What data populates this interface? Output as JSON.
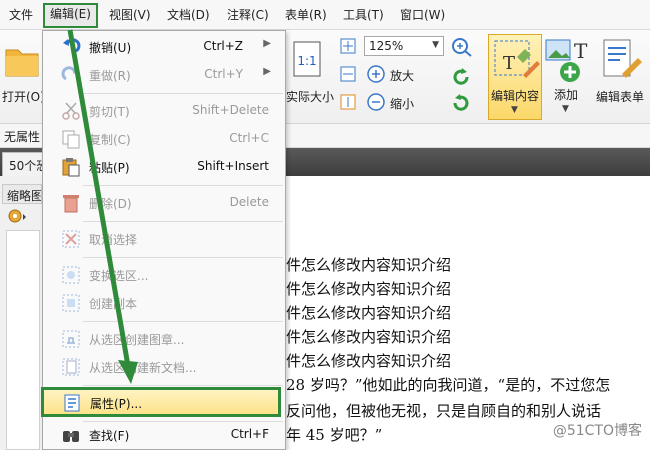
{
  "menubar": {
    "items": [
      "文件",
      "编辑(E)",
      "视图(V)",
      "文档(D)",
      "注释(C)",
      "表单(R)",
      "工具(T)",
      "窗口(W)"
    ],
    "active_index": 1
  },
  "ribbon": {
    "open_label": "打开(O)",
    "actual_size_label": "实际大小",
    "zoom_value": "125%",
    "zoom_in_label": "放大",
    "zoom_out_label": "缩小",
    "edit_content_label": "编辑内容",
    "add_label": "添加",
    "edit_form_label": "编辑表单"
  },
  "properties_row": {
    "label": "无属性"
  },
  "tabbar": {
    "tab_label": "50个恐"
  },
  "left_panel": {
    "header": "缩略图"
  },
  "document": {
    "lines": [
      "件怎么修改内容知识介绍",
      "件怎么修改内容知识介绍",
      "件怎么修改内容知识介绍",
      "件怎么修改内容知识介绍",
      "件怎么修改内容知识介绍",
      "28 岁吗？”他如此的向我问道，“是的，不过您怎",
      "反问他，但被他无视，只是自顾自的和别人说话",
      "年 45 岁吧？”"
    ],
    "watermark": "@51CTO博客"
  },
  "dropdown": {
    "undo": {
      "label": "撤销(U)",
      "shortcut": "Ctrl+Z"
    },
    "redo": {
      "label": "重做(R)",
      "shortcut": "Ctrl+Y"
    },
    "cut": {
      "label": "剪切(T)",
      "shortcut": "Shift+Delete"
    },
    "copy": {
      "label": "复制(C)",
      "shortcut": "Ctrl+C"
    },
    "paste": {
      "label": "粘贴(P)",
      "shortcut": "Shift+Insert"
    },
    "delete": {
      "label": "删除(D)",
      "shortcut": "Delete"
    },
    "deselect": {
      "label": "取消选择"
    },
    "transform_selection": {
      "label": "变换选区..."
    },
    "create_copy": {
      "label": "创建副本"
    },
    "create_stamp": {
      "label": "从选区创建图章..."
    },
    "create_document": {
      "label": "从选区创建新文档..."
    },
    "properties": {
      "label": "属性(P)..."
    },
    "find": {
      "label": "查找(F)",
      "shortcut": "Ctrl+F"
    }
  },
  "colors": {
    "highlight_border": "#2f8a3a",
    "highlight_fill": "#fde389",
    "arrow": "#2f8a3a"
  }
}
